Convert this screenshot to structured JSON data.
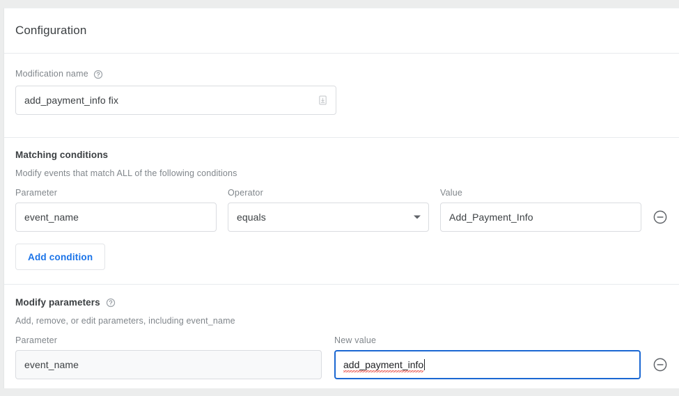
{
  "card": {
    "title": "Configuration"
  },
  "modification_name": {
    "label": "Modification name",
    "help_icon": "help-circle-icon",
    "value": "add_payment_info fix",
    "trailing_icon": "text-field-indicator-icon"
  },
  "matching_conditions": {
    "title": "Matching conditions",
    "description": "Modify events that match ALL of the following conditions",
    "columns": {
      "parameter": "Parameter",
      "operator": "Operator",
      "value": "Value"
    },
    "rows": [
      {
        "parameter": "event_name",
        "operator": "equals",
        "value": "Add_Payment_Info",
        "remove_icon": "remove-circle-icon",
        "dropdown_icon": "chevron-down-icon"
      }
    ],
    "add_button": "Add condition"
  },
  "modify_parameters": {
    "title": "Modify parameters",
    "help_icon": "help-circle-icon",
    "description": "Add, remove, or edit parameters, including event_name",
    "columns": {
      "parameter": "Parameter",
      "new_value": "New value"
    },
    "rows": [
      {
        "parameter": "event_name",
        "new_value": "add_payment_info",
        "remove_icon": "remove-circle-icon"
      }
    ]
  },
  "colors": {
    "accent_blue": "#1a73e8",
    "focus_blue": "#1a67d2",
    "spellcheck_red": "#e8453c",
    "text_primary": "#3c4043",
    "text_secondary": "#80868b",
    "border": "#dadce0",
    "page_background": "#eceded"
  }
}
